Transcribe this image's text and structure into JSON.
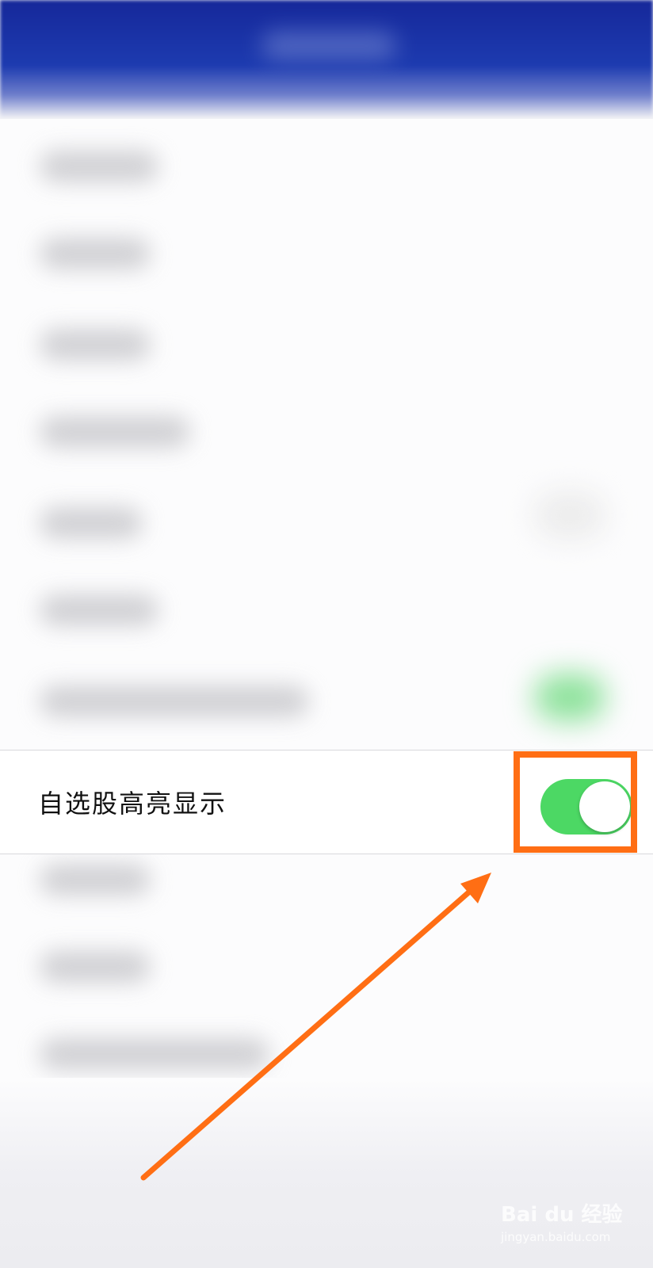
{
  "setting_row": {
    "label": "自选股高亮显示",
    "toggle_state": "on",
    "toggle_color": "#4cd864"
  },
  "annotation": {
    "color": "#ff6e14"
  },
  "watermark": {
    "brand": "Bai du 经验",
    "url": "jingyan.baidu.com"
  }
}
